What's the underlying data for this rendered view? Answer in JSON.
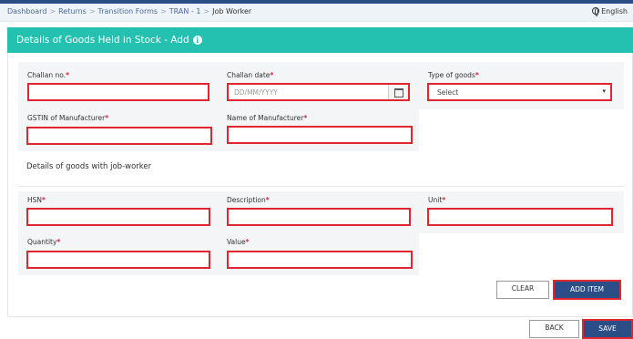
{
  "breadcrumb": [
    "Dashboard",
    "Returns",
    "Transition Forms",
    "TRAN - 1",
    "Job Worker"
  ],
  "language": "English",
  "panel": {
    "title": "Details of Goods Held in Stock - Add"
  },
  "form": {
    "challan_no_label": "Challan no.",
    "challan_date_label": "Challan date",
    "challan_date_placeholder": "DD/MM/YYYY",
    "type_of_goods_label": "Type of goods",
    "type_of_goods_value": "Select",
    "gstin_label": "GSTIN of Manufacturer",
    "name_label": "Name of Manufacturer",
    "required_mark": "*"
  },
  "job_worker": {
    "heading": "Details of goods with job-worker",
    "hsn_label": "HSN",
    "description_label": "Description",
    "unit_label": "Unit",
    "quantity_label": "Quantity",
    "value_label": "Value"
  },
  "buttons": {
    "clear": "CLEAR",
    "add_item": "ADD ITEM",
    "back": "BACK",
    "save": "SAVE"
  },
  "colors": {
    "header": "#24c1b0",
    "primary_button": "#2c4e86",
    "error_border": "#e2262f"
  }
}
